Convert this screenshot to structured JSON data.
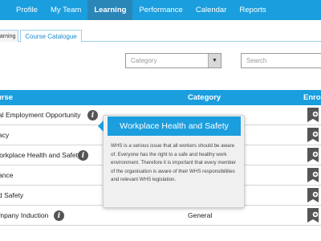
{
  "nav": {
    "items": [
      {
        "label": "Profile",
        "active": false
      },
      {
        "label": "My Team",
        "active": false
      },
      {
        "label": "Learning",
        "active": true
      },
      {
        "label": "Performance",
        "active": false
      },
      {
        "label": "Calendar",
        "active": false
      },
      {
        "label": "Reports",
        "active": false
      }
    ]
  },
  "tabs": {
    "my_learning": "earning",
    "course_catalogue": "Course Catalogue"
  },
  "filters": {
    "category_placeholder": "Category",
    "category_arrow": "▼",
    "search_placeholder": "Search"
  },
  "table": {
    "headers": {
      "course": "urse",
      "category": "Category",
      "enrol": "Enrol"
    },
    "rows": [
      {
        "title": "al Employment Opportunity",
        "category": ""
      },
      {
        "title": "acy",
        "category": ""
      },
      {
        "title": "Vorkplace Health and Safety",
        "category": ""
      },
      {
        "title": "ance",
        "category": ""
      },
      {
        "title": "d Safety",
        "category": ""
      },
      {
        "title": "mpany Induction",
        "category": "General"
      }
    ]
  },
  "popover": {
    "title": "Workplace Health and Safety",
    "body": "WHS is a serious issue that all workers should be aware of. Everyone has the right to a safe and healthy work environment. Therefore it is important that every member of the organisation is aware of their WHS responsibilities and relevant WHS legislation."
  },
  "icons": {
    "info": "info-icon",
    "enrol": "enrol-book-icon",
    "dropdown": "chevron-down-icon"
  },
  "colors": {
    "accent": "#1a9ede",
    "active_nav": "#2b86b8",
    "icon_dark": "#555555"
  }
}
